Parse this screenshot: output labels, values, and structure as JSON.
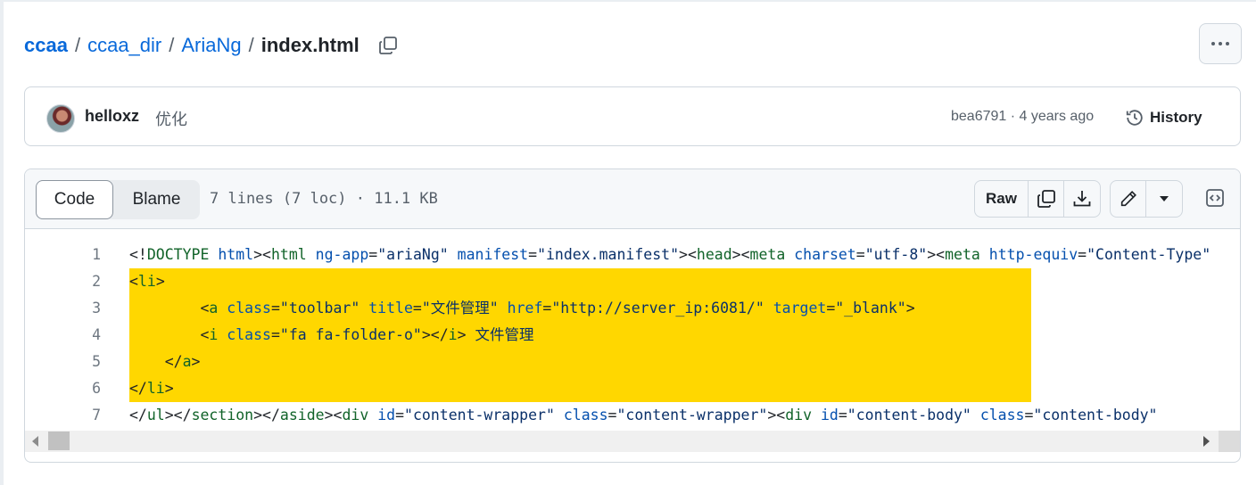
{
  "breadcrumb": {
    "owner": "ccaa",
    "path": [
      "ccaa_dir",
      "AriaNg"
    ],
    "separator": "/",
    "file": "index.html"
  },
  "commit": {
    "author": "helloxz",
    "message": "优化",
    "sha": "bea6791",
    "meta_sep": " · ",
    "age": "4 years ago",
    "history_label": "History"
  },
  "file": {
    "tabs": {
      "code": "Code",
      "blame": "Blame"
    },
    "info": "7 lines (7 loc) · 11.1 KB",
    "raw_label": "Raw"
  },
  "code": {
    "lines": [
      {
        "n": "1",
        "highlighted": false,
        "tokens": [
          [
            "p",
            "<!"
          ],
          [
            "tag",
            "DOCTYPE"
          ],
          [
            "p",
            " "
          ],
          [
            "attr",
            "html"
          ],
          [
            "p",
            "><"
          ],
          [
            "tag",
            "html"
          ],
          [
            "p",
            " "
          ],
          [
            "attr",
            "ng-app"
          ],
          [
            "p",
            "="
          ],
          [
            "str",
            "\"ariaNg\""
          ],
          [
            "p",
            " "
          ],
          [
            "attr",
            "manifest"
          ],
          [
            "p",
            "="
          ],
          [
            "str",
            "\"index.manifest\""
          ],
          [
            "p",
            "><"
          ],
          [
            "tag",
            "head"
          ],
          [
            "p",
            "><"
          ],
          [
            "tag",
            "meta"
          ],
          [
            "p",
            " "
          ],
          [
            "attr",
            "charset"
          ],
          [
            "p",
            "="
          ],
          [
            "str",
            "\"utf-8\""
          ],
          [
            "p",
            "><"
          ],
          [
            "tag",
            "meta"
          ],
          [
            "p",
            " "
          ],
          [
            "attr",
            "http-equiv"
          ],
          [
            "p",
            "="
          ],
          [
            "str",
            "\"Content-Type\""
          ]
        ]
      },
      {
        "n": "2",
        "highlighted": true,
        "tokens": [
          [
            "p",
            "<"
          ],
          [
            "tag",
            "li"
          ],
          [
            "p",
            ">"
          ]
        ]
      },
      {
        "n": "3",
        "highlighted": true,
        "tokens": [
          [
            "p",
            "        <"
          ],
          [
            "tag",
            "a"
          ],
          [
            "p",
            " "
          ],
          [
            "attr",
            "class"
          ],
          [
            "p",
            "="
          ],
          [
            "str",
            "\"toolbar\""
          ],
          [
            "p",
            " "
          ],
          [
            "attr",
            "title"
          ],
          [
            "p",
            "="
          ],
          [
            "str",
            "\""
          ],
          [
            "cjk",
            "文件管理"
          ],
          [
            "str",
            "\""
          ],
          [
            "p",
            " "
          ],
          [
            "attr",
            "href"
          ],
          [
            "p",
            "="
          ],
          [
            "str",
            "\"http://server_ip:6081/\""
          ],
          [
            "p",
            " "
          ],
          [
            "attr",
            "target"
          ],
          [
            "p",
            "="
          ],
          [
            "str",
            "\"_blank\""
          ],
          [
            "p",
            ">"
          ]
        ]
      },
      {
        "n": "4",
        "highlighted": true,
        "tokens": [
          [
            "p",
            "        <"
          ],
          [
            "tag",
            "i"
          ],
          [
            "p",
            " "
          ],
          [
            "attr",
            "class"
          ],
          [
            "p",
            "="
          ],
          [
            "str",
            "\"fa fa-folder-o\""
          ],
          [
            "p",
            "></"
          ],
          [
            "tag",
            "i"
          ],
          [
            "p",
            "> "
          ],
          [
            "cjk",
            "文件管理"
          ]
        ]
      },
      {
        "n": "5",
        "highlighted": true,
        "tokens": [
          [
            "p",
            "    </"
          ],
          [
            "tag",
            "a"
          ],
          [
            "p",
            ">"
          ]
        ]
      },
      {
        "n": "6",
        "highlighted": true,
        "tokens": [
          [
            "p",
            "</"
          ],
          [
            "tag",
            "li"
          ],
          [
            "p",
            ">"
          ]
        ]
      },
      {
        "n": "7",
        "highlighted": false,
        "tokens": [
          [
            "p",
            "</"
          ],
          [
            "tag",
            "ul"
          ],
          [
            "p",
            "></"
          ],
          [
            "tag",
            "section"
          ],
          [
            "p",
            "></"
          ],
          [
            "tag",
            "aside"
          ],
          [
            "p",
            "><"
          ],
          [
            "tag",
            "div"
          ],
          [
            "p",
            " "
          ],
          [
            "attr",
            "id"
          ],
          [
            "p",
            "="
          ],
          [
            "str",
            "\"content-wrapper\""
          ],
          [
            "p",
            " "
          ],
          [
            "attr",
            "class"
          ],
          [
            "p",
            "="
          ],
          [
            "str",
            "\"content-wrapper\""
          ],
          [
            "p",
            "><"
          ],
          [
            "tag",
            "div"
          ],
          [
            "p",
            " "
          ],
          [
            "attr",
            "id"
          ],
          [
            "p",
            "="
          ],
          [
            "str",
            "\"content-body\""
          ],
          [
            "p",
            " "
          ],
          [
            "attr",
            "class"
          ],
          [
            "p",
            "="
          ],
          [
            "str",
            "\"content-body\""
          ]
        ]
      }
    ]
  },
  "icons": {
    "copy_path": "copy-icon",
    "more": "kebab-horizontal-icon",
    "history": "history-clock-icon",
    "copy_raw": "copy-icon",
    "download": "download-icon",
    "edit": "pencil-icon",
    "edit_menu": "triangle-down-icon",
    "symbols": "code-square-icon"
  },
  "colors": {
    "link": "#0969da",
    "highlight": "#ffd700",
    "tag": "#116329",
    "attr": "#0550ae",
    "string": "#0a3069"
  }
}
